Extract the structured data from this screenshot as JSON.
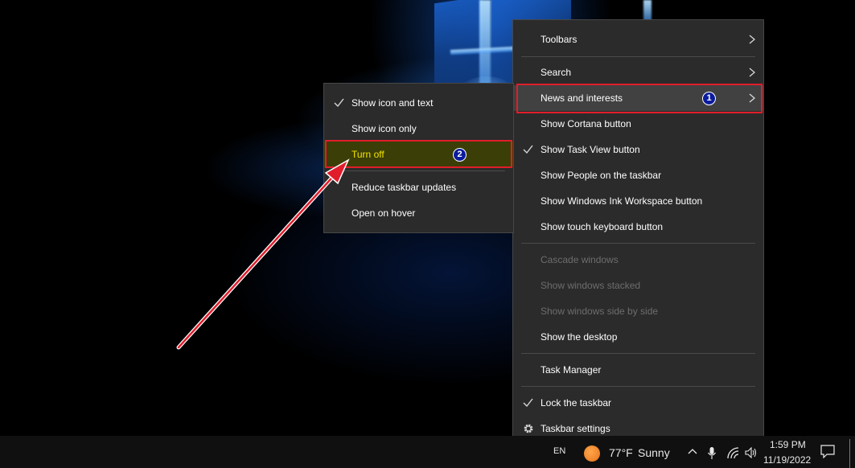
{
  "right_menu": {
    "items": [
      {
        "label": "Toolbars",
        "submenu": true
      },
      {
        "label": "Search",
        "submenu": true
      },
      {
        "label": "News and interests",
        "submenu": true,
        "badge": "1"
      },
      {
        "label": "Show Cortana button"
      },
      {
        "label": "Show Task View button",
        "checked": true
      },
      {
        "label": "Show People on the taskbar"
      },
      {
        "label": "Show Windows Ink Workspace button"
      },
      {
        "label": "Show touch keyboard button"
      },
      {
        "label": "Cascade windows",
        "disabled": true
      },
      {
        "label": "Show windows stacked",
        "disabled": true
      },
      {
        "label": "Show windows side by side",
        "disabled": true
      },
      {
        "label": "Show the desktop"
      },
      {
        "label": "Task Manager"
      },
      {
        "label": "Lock the taskbar",
        "checked": true
      },
      {
        "label": "Taskbar settings",
        "icon": "gear-icon"
      }
    ]
  },
  "sub_menu": {
    "items": [
      {
        "label": "Show icon and text",
        "checked": true
      },
      {
        "label": "Show icon only"
      },
      {
        "label": "Turn off",
        "badge": "2",
        "highlight_color": "#3b3e06",
        "text_color": "#f2e400"
      },
      {
        "label": "Reduce taskbar updates"
      },
      {
        "label": "Open on hover"
      }
    ]
  },
  "annotation": {
    "color": "#e11d2b",
    "arrow": "red-arrow"
  },
  "taskbar": {
    "language": "EN",
    "weather_temp": "77°F",
    "weather_desc": "Sunny",
    "time": "1:59 PM",
    "date": "11/19/2022",
    "icons": [
      "weather-sun-icon",
      "chevron-up-icon",
      "microphone-icon",
      "network-icon",
      "volume-icon",
      "notification-icon"
    ]
  }
}
